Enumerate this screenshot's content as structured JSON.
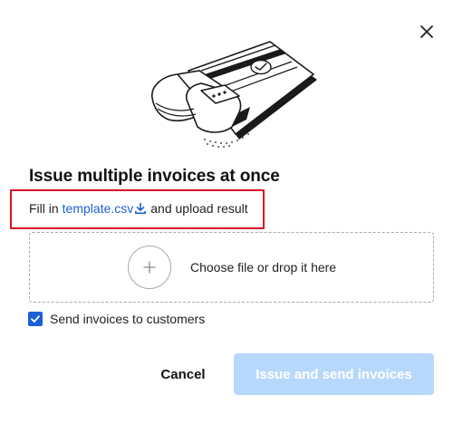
{
  "dialog": {
    "title": "Issue multiple invoices at once",
    "instruction": {
      "prefix": "Fill in",
      "link_label": "template.csv",
      "suffix": "and upload result"
    },
    "dropzone": {
      "label": "Choose file or drop it here"
    },
    "checkbox": {
      "label": "Send invoices to customers",
      "checked": true
    },
    "actions": {
      "cancel_label": "Cancel",
      "primary_label": "Issue and send invoices",
      "primary_disabled": true
    },
    "icons": {
      "close": "close-icon",
      "download": "download-icon",
      "add": "plus-icon",
      "check": "check-icon"
    }
  },
  "colors": {
    "link": "#1a5fd6",
    "checkbox": "#1a5fd6",
    "primary_disabled_bg": "#b8d8fb",
    "highlight_border": "#d6161f"
  }
}
